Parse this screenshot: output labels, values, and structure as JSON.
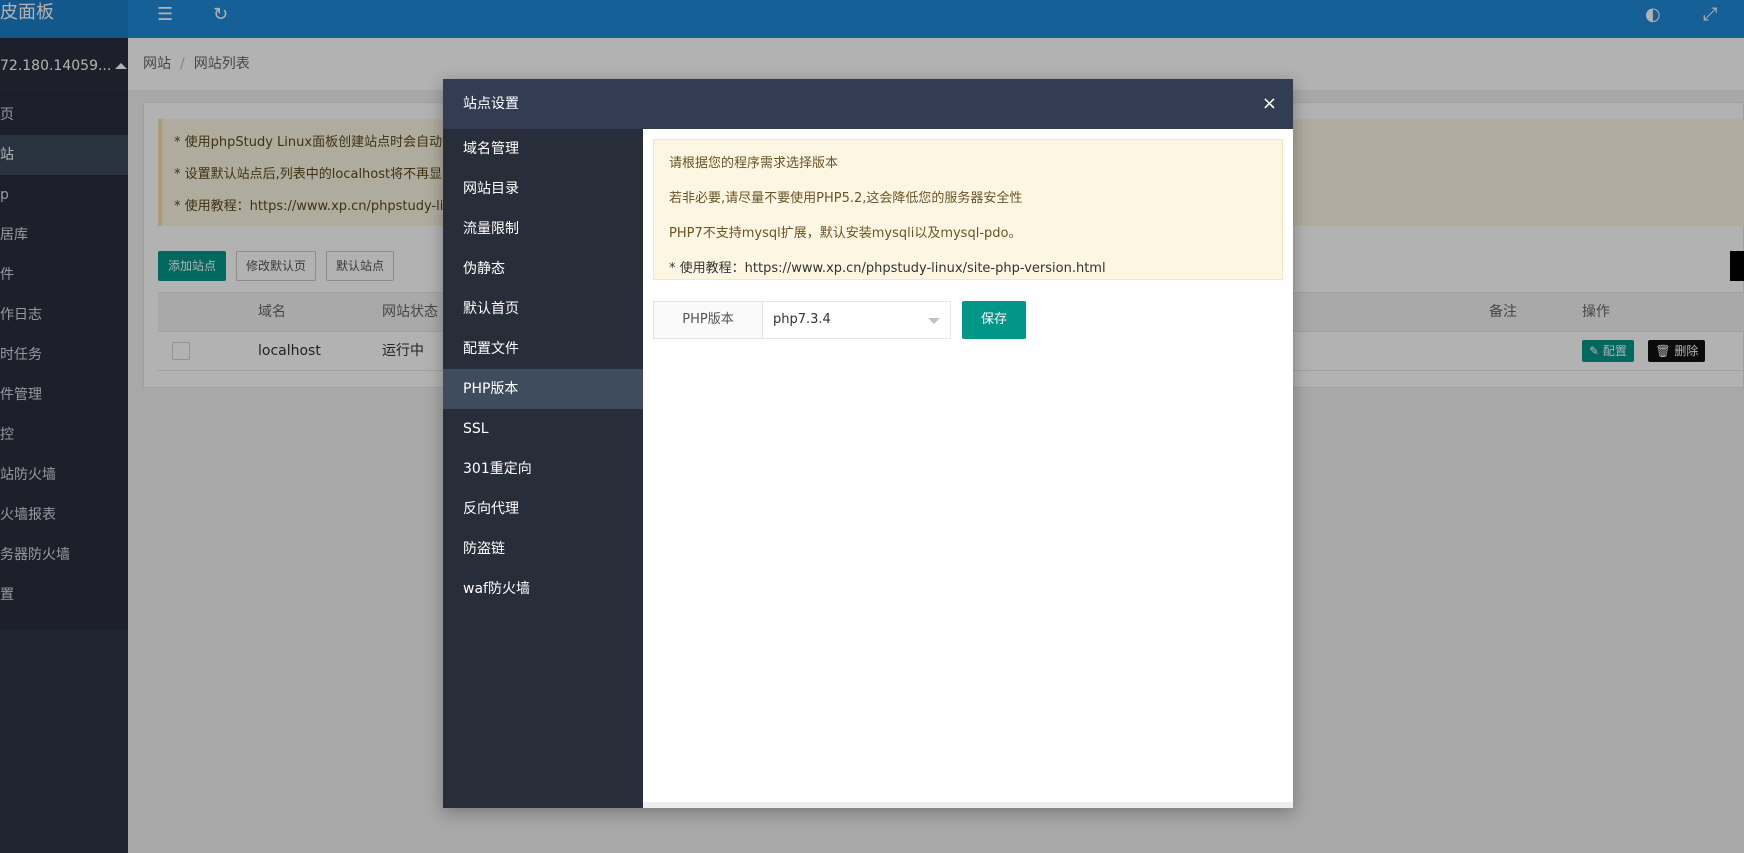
{
  "app": {
    "brand": "皮面板"
  },
  "sidebar": {
    "server": "72.180.14059...",
    "items": [
      {
        "label": "页"
      },
      {
        "label": "站"
      },
      {
        "label": "p"
      },
      {
        "label": "居库"
      },
      {
        "label": "件"
      },
      {
        "label": "作日志"
      },
      {
        "label": "时任务"
      },
      {
        "label": "件管理"
      },
      {
        "label": "控"
      },
      {
        "label": "站防火墙"
      },
      {
        "label": "火墙报表"
      },
      {
        "label": "务器防火墙"
      },
      {
        "label": "置"
      }
    ]
  },
  "breadcrumb": {
    "root": "网站",
    "separator": "/",
    "current": "网站列表"
  },
  "notice": {
    "lines": [
      "* 使用phpStudy Linux面板创建站点时会自动",
      "* 设置默认站点后,列表中的localhost将不再显",
      "* 使用教程：https://www.xp.cn/phpstudy-lin"
    ]
  },
  "buttons": {
    "add_site": "添加站点",
    "edit_default_page": "修改默认页",
    "default_site": "默认站点"
  },
  "table": {
    "headers": {
      "domain": "域名",
      "status": "网站状态",
      "remark": "备注",
      "actions": "操作"
    },
    "rows": [
      {
        "domain": "localhost",
        "status": "运行中",
        "config": "配置",
        "delete": "删除"
      }
    ]
  },
  "modal": {
    "title": "站点设置",
    "close": "×",
    "menu": [
      {
        "label": "域名管理"
      },
      {
        "label": "网站目录"
      },
      {
        "label": "流量限制"
      },
      {
        "label": "伪静态"
      },
      {
        "label": "默认首页"
      },
      {
        "label": "配置文件"
      },
      {
        "label": "PHP版本"
      },
      {
        "label": "SSL"
      },
      {
        "label": "301重定向"
      },
      {
        "label": "反向代理"
      },
      {
        "label": "防盗链"
      },
      {
        "label": "waf防火墙"
      }
    ],
    "active_menu": "PHP版本",
    "tips": [
      "请根据您的程序需求选择版本",
      "若非必要,请尽量不要使用PHP5.2,这会降低您的服务器安全性",
      "PHP7不支持mysql扩展，默认安装mysqli以及mysql-pdo。",
      "* 使用教程：https://www.xp.cn/phpstudy-linux/site-php-version.html"
    ],
    "php_label": "PHP版本",
    "php_value": "php7.3.4",
    "save": "保存"
  },
  "colors": {
    "topbar": "#1f8ad9",
    "accent": "#009688",
    "modal_header": "#323c52",
    "modal_menu": "#282d3a"
  }
}
